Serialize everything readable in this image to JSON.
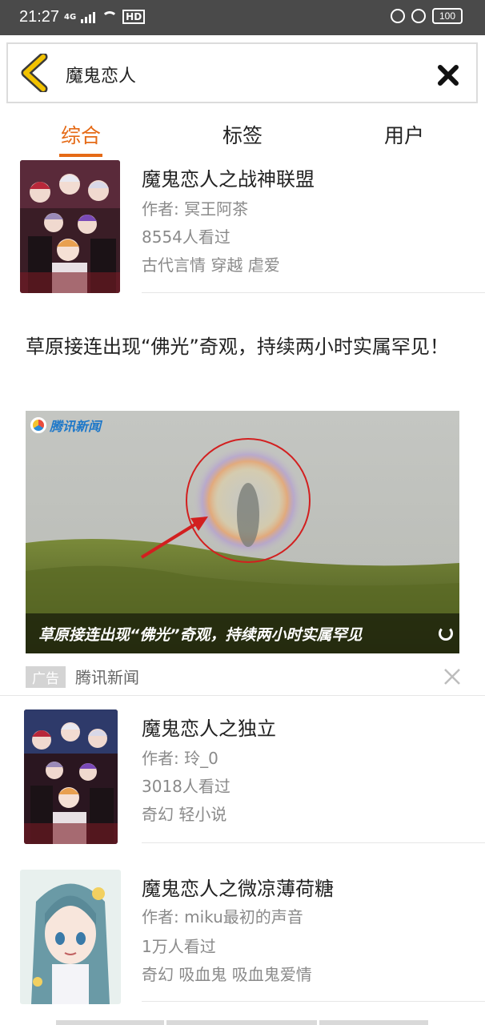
{
  "status_bar": {
    "time": "21:27",
    "network": "4G",
    "hd": "HD",
    "battery": "100"
  },
  "search": {
    "query": "魔鬼恋人"
  },
  "tabs": [
    {
      "label": "综合",
      "active": true
    },
    {
      "label": "标签",
      "active": false
    },
    {
      "label": "用户",
      "active": false
    }
  ],
  "books": [
    {
      "title": "魔鬼恋人之战神联盟",
      "author": "作者: 冥王阿茶",
      "views": "8554人看过",
      "tags": "古代言情 穿越 虐爱",
      "cover": "anime-group-cover"
    },
    {
      "title": "魔鬼恋人之独立",
      "author": "作者: 玲_0",
      "views": "3018人看过",
      "tags": "奇幻 轻小说",
      "cover": "anime-group-cover"
    },
    {
      "title": "魔鬼恋人之微凉薄荷糖",
      "author": "作者: miku最初的声音",
      "views": "1万人看过",
      "tags": "奇幻 吸血鬼 吸血鬼爱情",
      "cover": "anime-girl-cover"
    }
  ],
  "ad": {
    "headline": "草原接连出现“佛光”奇观，持续两小时实属罕见！",
    "logo_text": "腾讯新闻",
    "image_caption": "草原接连出现“佛光”奇观，持续两小时实属罕见",
    "tag": "广告",
    "source": "腾讯新闻"
  },
  "colors": {
    "accent": "#e56a16",
    "status_bar": "#4a4a4a",
    "meta_text": "#8a8a8a"
  }
}
